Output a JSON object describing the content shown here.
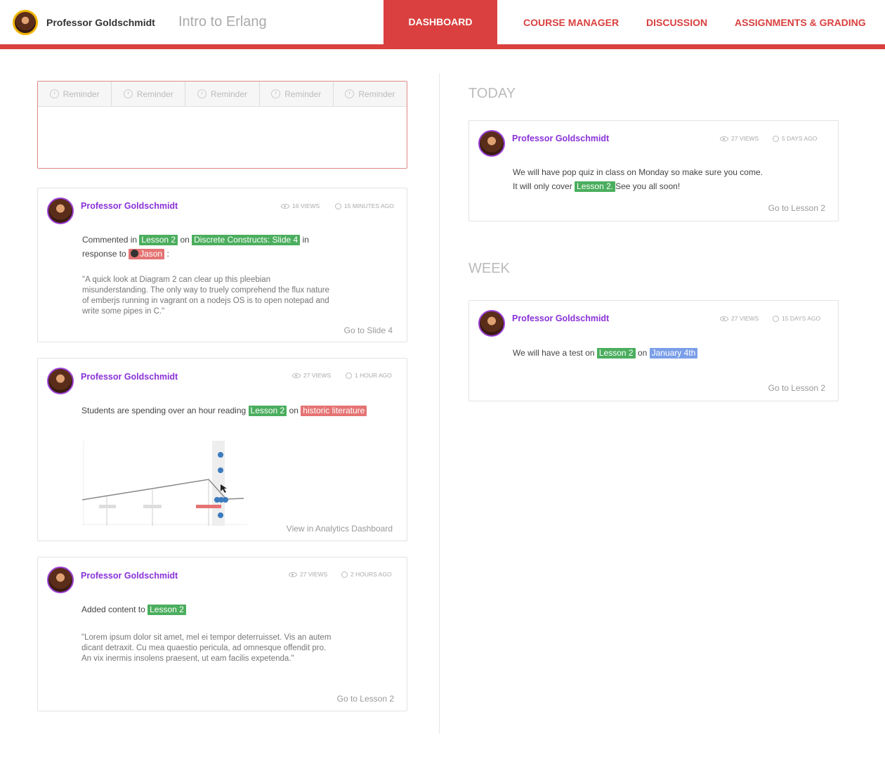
{
  "header": {
    "user_name": "Professor Goldschmidt",
    "course": "Intro to Erlang",
    "nav": [
      "DASHBOARD",
      "COURSE MANAGER",
      "DISCUSSION",
      "ASSIGNMENTS & GRADING"
    ],
    "active_nav": "DASHBOARD"
  },
  "reminders": {
    "tabs": [
      "Reminder",
      "Reminder",
      "Reminder",
      "Reminder",
      "Reminder"
    ]
  },
  "feed": [
    {
      "author": "Professor Goldschmidt",
      "views": "16 VIEWS",
      "time": "15 MINUTES AGO",
      "line1_a": "Commented in",
      "line1_tag1": "Lesson 2",
      "line1_b": "on",
      "line1_tag2": "Discrete Constructs: Slide 4",
      "line1_c": "in",
      "line2_a": "response to",
      "line2_tag": "Jason",
      "line2_b": ":",
      "quote": "\"A quick look at Diagram 2 can clear up this pleebian misunderstanding. The only way to truely comprehend the flux nature of emberjs running in vagrant on a nodejs OS is to open notepad and write some pipes in C.\"",
      "link": "Go to Slide 4"
    },
    {
      "author": "Professor Goldschmidt",
      "views": "27 VIEWS",
      "time": "1 HOUR AGO",
      "text_a": "Students are spending over an hour reading",
      "tag1": "Lesson 2",
      "text_b": "on",
      "tag2": "historic literature",
      "link": "View in Analytics Dashboard"
    },
    {
      "author": "Professor Goldschmidt",
      "views": "27 VIEWS",
      "time": "2 HOURS AGO",
      "text_a": "Added content to",
      "tag1": "Lesson 2",
      "quote": "\"Lorem ipsum dolor sit amet, mel ei tempor deterruisset. Vis an autem dicant detraxit. Cu mea quaestio pericula, ad omnesque offendit pro. An vix inermis insolens praesent, ut eam facilis expetenda.\"",
      "link": "Go to Lesson 2"
    }
  ],
  "today": {
    "title": "TODAY",
    "author": "Professor Goldschmidt",
    "views": "27 VIEWS",
    "time": "5 DAYS AGO",
    "line1": "We will have pop quiz in class on Monday so make sure you come.",
    "line2_a": "It will only cover",
    "line2_tag": "Lesson 2.",
    "line2_b": "See you all soon!",
    "link": "Go to Lesson 2"
  },
  "week": {
    "title": "WEEK",
    "author": "Professor Goldschmidt",
    "views": "27 VIEWS",
    "time": "15 DAYS AGO",
    "text_a": "We will have a test on",
    "tag1": "Lesson 2",
    "text_b": "on",
    "tag2": "January 4th",
    "link": "Go to Lesson 2"
  }
}
